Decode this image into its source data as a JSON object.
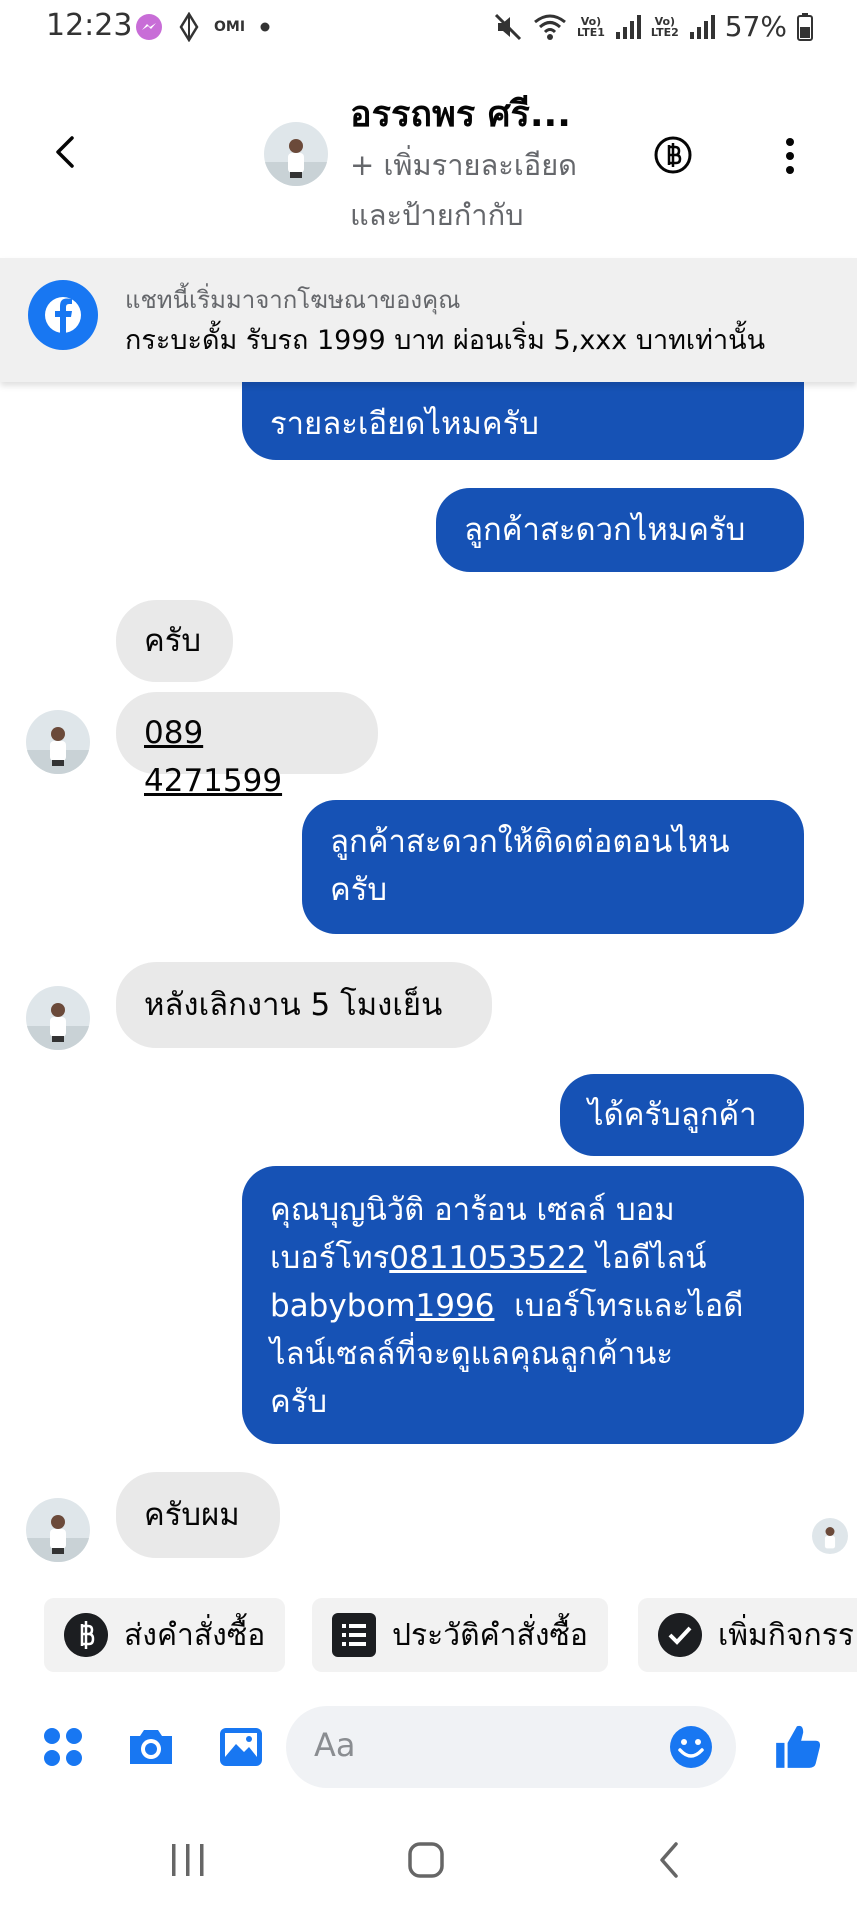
{
  "status_bar": {
    "time": "12:23",
    "left_icons": [
      "messenger-icon",
      "diamond-icon",
      "omi-text",
      "dot-icon"
    ],
    "omi": "OMI",
    "battery": "57%",
    "sim1": "Vo)\nLTE1",
    "sim2": "Vo)\nLTE2"
  },
  "header": {
    "name": "อรรถพร ศรี...",
    "subtitle": "+ เพิ่มรายละเอียด และป้ายกำกับ"
  },
  "ad_banner": {
    "line1": "แชทนี้เริ่มมาจากโฆษณาของคุณ",
    "line2": "กระบะดั้ม  รับรถ 1999 บาท ผ่อนเริ่ม 5,xxx บาทเท่านั้น"
  },
  "messages": [
    {
      "dir": "out",
      "text": "รายละเอียดไหมครับ"
    },
    {
      "dir": "out",
      "text": "ลูกค้าสะดวกไหมครับ"
    },
    {
      "dir": "in",
      "text": "ครับ"
    },
    {
      "dir": "in",
      "text": "089 4271599"
    },
    {
      "dir": "out",
      "line1": "ลูกค้าสะดวกให้ติดต่อตอนไหน",
      "line2": "ครับ"
    },
    {
      "dir": "in",
      "text": "หลังเลิกงาน 5 โมงเย็น"
    },
    {
      "dir": "out",
      "text": "ได้ครับลูกค้า"
    },
    {
      "dir": "out",
      "l1": "คุณบุญนิวัติ อาร้อน เซลล์ บอม",
      "l2a": "เบอร์โทร",
      "l2b": "0811053522",
      "l2c": " ไอดีไลน์",
      "l3a": "babybom",
      "l3b": "1996",
      "l3c": "  เบอร์โทรและไอดี",
      "l4": "ไลน์เซลล์ที่จะดูแลคุณลูกค้านะ",
      "l5": "ครับ"
    },
    {
      "dir": "in",
      "text": "ครับผม"
    }
  ],
  "quick_actions": [
    {
      "label": "ส่งคำสั่งซื้อ",
      "icon": "baht-icon"
    },
    {
      "label": "ประวัติคำสั่งซื้อ",
      "icon": "list-icon"
    },
    {
      "label": "เพิ่มกิจกรร",
      "icon": "check-circle-icon"
    }
  ],
  "composer": {
    "placeholder": "Aa"
  },
  "colors": {
    "outgoing_bubble": "#1652b5",
    "incoming_bubble": "#e9e9e9",
    "accent": "#1877f2"
  }
}
